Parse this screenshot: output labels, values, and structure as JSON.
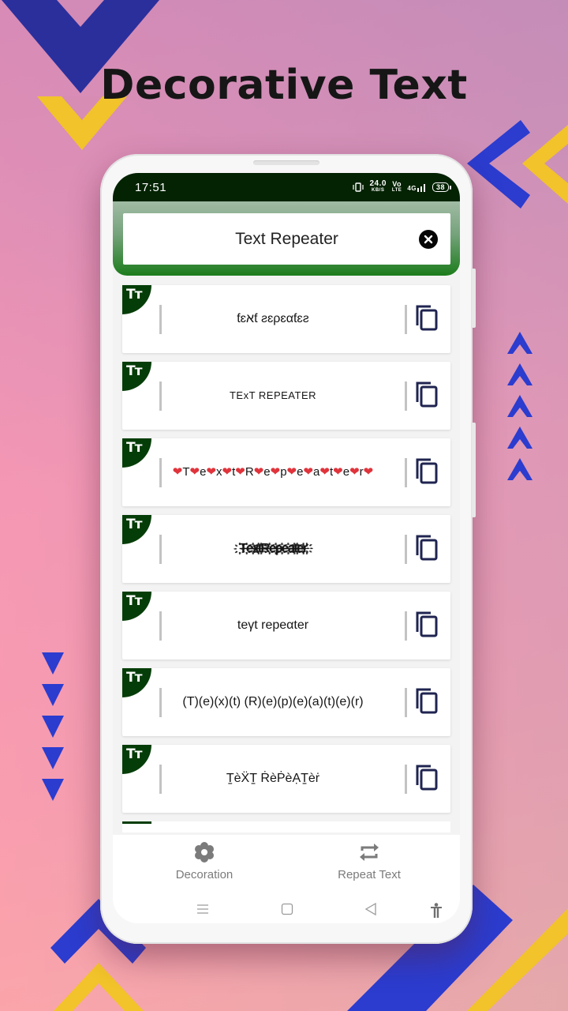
{
  "promo": {
    "headline": "Decorative Text"
  },
  "status_bar": {
    "time": "17:51",
    "net_speed": "24.0",
    "net_unit": "KB/S",
    "volte": "Vo",
    "lte": "LTE",
    "network": "4G",
    "battery": "38"
  },
  "search": {
    "value": "Text Repeater",
    "clear_icon": "close-circle-icon"
  },
  "styled_items": [
    {
      "text": "ƭɛאƭ ƨɛρɛαƭɛƨ",
      "style": "mirror"
    },
    {
      "text": "TExT REPEATER",
      "style": "small-caps"
    },
    {
      "text": "❤T❤e❤x❤t❤R❤e❤p❤e❤a❤t❤e❤r❤",
      "style": "hearts"
    },
    {
      "text": "҉T҉e҉x҉t҉R҉e҉p҉e҉a҉t҉e҉r҉",
      "style": "glitch"
    },
    {
      "text": "teγt repeαter",
      "style": "runic"
    },
    {
      "text": "(T)(e)(x)(t) (R)(e)(p)(e)(a)(t)(e)(r)",
      "style": "parenthesized"
    },
    {
      "text": "T̠èẌT̠ ṘèṖèẠT̠èṙ",
      "style": "diacritics"
    }
  ],
  "item_badge": "Tт",
  "item_action_icon": "copy-icon",
  "bottom_nav": [
    {
      "label": "Decoration",
      "icon": "flower-icon"
    },
    {
      "label": "Repeat Text",
      "icon": "repeat-icon"
    }
  ],
  "colors": {
    "accent_green": "#053d08",
    "status_bar": "#032302",
    "deco_blue": "#2b3ccf",
    "deco_yellow": "#f2c32a"
  }
}
